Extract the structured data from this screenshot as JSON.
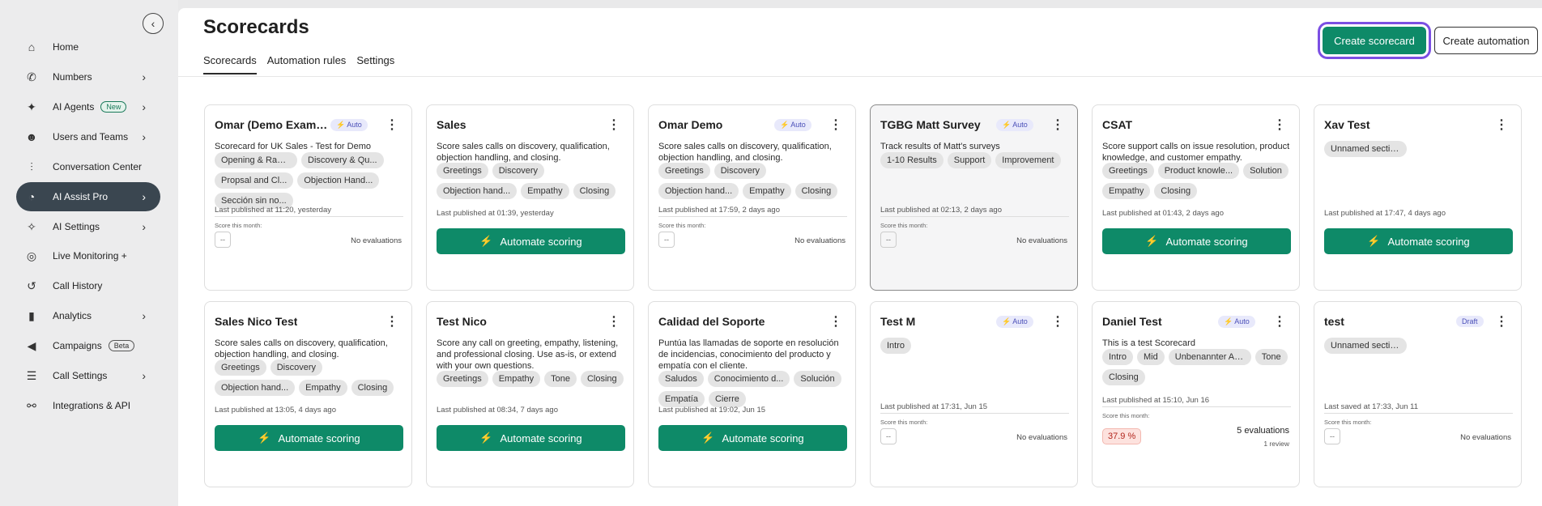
{
  "sidebar": {
    "collapse_icon": "chevron-left-icon",
    "items": [
      {
        "label": "Home",
        "icon": "home-icon",
        "glyph": "⌂",
        "chevron": false,
        "pill": ""
      },
      {
        "label": "Numbers",
        "icon": "phone-icon",
        "glyph": "✆",
        "chevron": true,
        "pill": ""
      },
      {
        "label": "AI Agents",
        "icon": "ai-agents-icon",
        "glyph": "✦",
        "chevron": true,
        "pill": "New"
      },
      {
        "label": "Users and Teams",
        "icon": "users-icon",
        "glyph": "☻",
        "chevron": true,
        "pill": ""
      },
      {
        "label": "Conversation Center",
        "icon": "waveform-icon",
        "glyph": "⫶",
        "chevron": false,
        "pill": ""
      },
      {
        "label": "AI Assist Pro",
        "icon": "ai-assist-icon",
        "glyph": "◔",
        "chevron": true,
        "pill": "",
        "active": true
      },
      {
        "label": "AI Settings",
        "icon": "ai-settings-icon",
        "glyph": "✧",
        "chevron": true,
        "pill": ""
      },
      {
        "label": "Live Monitoring +",
        "icon": "live-monitoring-icon",
        "glyph": "◎",
        "chevron": false,
        "pill": ""
      },
      {
        "label": "Call History",
        "icon": "call-history-icon",
        "glyph": "↺",
        "chevron": false,
        "pill": ""
      },
      {
        "label": "Analytics",
        "icon": "analytics-icon",
        "glyph": "▮",
        "chevron": true,
        "pill": ""
      },
      {
        "label": "Campaigns",
        "icon": "megaphone-icon",
        "glyph": "◀",
        "chevron": false,
        "pill": "Beta"
      },
      {
        "label": "Call Settings",
        "icon": "sliders-icon",
        "glyph": "☰",
        "chevron": true,
        "pill": ""
      },
      {
        "label": "Integrations & API",
        "icon": "integrations-icon",
        "glyph": "⚯",
        "chevron": false,
        "pill": ""
      }
    ]
  },
  "header": {
    "title": "Scorecards",
    "tabs": [
      "Scorecards",
      "Automation rules",
      "Settings"
    ],
    "create_scorecard": "Create scorecard",
    "create_automation": "Create automation"
  },
  "cards": [
    {
      "title": "Omar (Demo Examp...",
      "badge": "Auto",
      "desc": "Scorecard for UK Sales - Test for Demo",
      "chips": [
        "Opening & Rapp...",
        "Discovery & Qu...",
        "Propsal and Cl...",
        "Objection Hand...",
        "Sección sin no..."
      ],
      "published": "Last published at 11:20, yesterday",
      "footer": "score",
      "score_label": "Score this month:",
      "score": "--",
      "evals": "No evaluations"
    },
    {
      "title": "Sales",
      "badge": "",
      "desc": "Score sales calls on discovery, qualification, objection handling, and closing.",
      "chips": [
        "Greetings",
        "Discovery",
        "Objection hand...",
        "Empathy",
        "Closing"
      ],
      "published": "Last published at 01:39, yesterday",
      "footer": "automate",
      "automate": "Automate scoring"
    },
    {
      "title": "Omar Demo",
      "badge": "Auto",
      "desc": "Score sales calls on discovery, qualification, objection handling, and closing.",
      "chips": [
        "Greetings",
        "Discovery",
        "Objection hand...",
        "Empathy",
        "Closing"
      ],
      "published": "Last published at 17:59, 2 days ago",
      "footer": "score",
      "score_label": "Score this month:",
      "score": "--",
      "evals": "No evaluations"
    },
    {
      "title": "TGBG Matt Survey",
      "badge": "Auto",
      "desc": "Track results of Matt's surveys",
      "chips": [
        "1-10 Results",
        "Support",
        "Improvement"
      ],
      "published": "Last published at 02:13, 2 days ago",
      "footer": "score",
      "score_label": "Score this month:",
      "score": "--",
      "evals": "No evaluations",
      "highlight": true
    },
    {
      "title": "CSAT",
      "badge": "",
      "desc": "Score support calls on issue resolution, product knowledge, and customer empathy.",
      "chips": [
        "Greetings",
        "Product knowle...",
        "Solution",
        "Empathy",
        "Closing"
      ],
      "published": "Last published at 01:43, 2 days ago",
      "footer": "automate",
      "automate": "Automate scoring"
    },
    {
      "title": "Xav Test",
      "badge": "",
      "desc": "",
      "chips": [
        "Unnamed sectio..."
      ],
      "published": "Last published at 17:47, 4 days ago",
      "footer": "automate",
      "automate": "Automate scoring"
    },
    {
      "title": "Sales Nico Test",
      "badge": "",
      "desc": "Score sales calls on discovery, qualification, objection handling, and closing.",
      "chips": [
        "Greetings",
        "Discovery",
        "Objection hand...",
        "Empathy",
        "Closing"
      ],
      "published": "Last published at 13:05, 4 days ago",
      "footer": "automate",
      "automate": "Automate scoring"
    },
    {
      "title": "Test Nico",
      "badge": "",
      "desc": "Score any call on greeting, empathy, listening, and professional closing. Use as-is, or extend with your own questions.",
      "chips": [
        "Greetings",
        "Empathy",
        "Tone",
        "Closing"
      ],
      "published": "Last published at 08:34, 7 days ago",
      "footer": "automate",
      "automate": "Automate scoring"
    },
    {
      "title": "Calidad del Soporte",
      "badge": "",
      "desc": "Puntúa las llamadas de soporte en resolución de incidencias, conocimiento del producto y empatía con el cliente.",
      "chips": [
        "Saludos",
        "Conocimiento d...",
        "Solución",
        "Empatía",
        "Cierre"
      ],
      "published": "Last published at 19:02, Jun 15",
      "footer": "automate",
      "automate": "Automate scoring"
    },
    {
      "title": "Test M",
      "badge": "Auto",
      "desc": "",
      "chips": [
        "Intro"
      ],
      "published": "Last published at 17:31, Jun 15",
      "footer": "score",
      "score_label": "Score this month:",
      "score": "--",
      "evals": "No evaluations"
    },
    {
      "title": "Daniel Test",
      "badge": "Auto",
      "desc": "This is a test Scorecard",
      "chips": [
        "Intro",
        "Mid",
        "Unbenannter Ab...",
        "Tone",
        "Closing"
      ],
      "published": "Last published at 15:10, Jun 16",
      "footer": "percent",
      "score_label": "Score this month:",
      "percent": "37.9 %",
      "evals": "5 evaluations",
      "review": "1 review"
    },
    {
      "title": "test",
      "badge": "Draft",
      "desc": "",
      "chips": [
        "Unnamed sectio..."
      ],
      "published": "Last saved at 17:33, Jun 11",
      "footer": "score",
      "score_label": "Score this month:",
      "score": "--",
      "evals": "No evaluations"
    }
  ]
}
